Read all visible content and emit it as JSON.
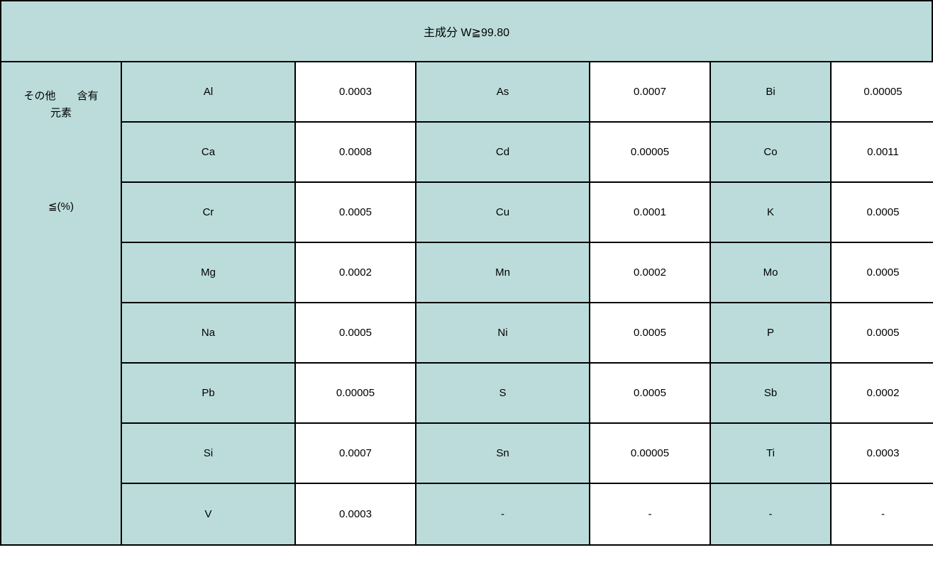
{
  "header": "主成分   W≧99.80",
  "sidebar": {
    "line1": "その他　　含有",
    "line2": "元素",
    "unit": "≦(%)"
  },
  "rows": [
    {
      "e1": "Al",
      "v1": "0.0003",
      "e2": "As",
      "v2": "0.0007",
      "e3": "Bi",
      "v3": "0.00005"
    },
    {
      "e1": "Ca",
      "v1": "0.0008",
      "e2": "Cd",
      "v2": "0.00005",
      "e3": "Co",
      "v3": "0.0011"
    },
    {
      "e1": "Cr",
      "v1": "0.0005",
      "e2": "Cu",
      "v2": "0.0001",
      "e3": "K",
      "v3": "0.0005"
    },
    {
      "e1": "Mg",
      "v1": "0.0002",
      "e2": "Mn",
      "v2": "0.0002",
      "e3": "Mo",
      "v3": "0.0005"
    },
    {
      "e1": "Na",
      "v1": "0.0005",
      "e2": "Ni",
      "v2": "0.0005",
      "e3": "P",
      "v3": "0.0005"
    },
    {
      "e1": "Pb",
      "v1": "0.00005",
      "e2": "S",
      "v2": "0.0005",
      "e3": "Sb",
      "v3": "0.0002"
    },
    {
      "e1": "Si",
      "v1": "0.0007",
      "e2": "Sn",
      "v2": "0.00005",
      "e3": "Ti",
      "v3": "0.0003"
    },
    {
      "e1": "V",
      "v1": "0.0003",
      "e2": "-",
      "v2": "-",
      "e3": "-",
      "v3": "-"
    }
  ]
}
